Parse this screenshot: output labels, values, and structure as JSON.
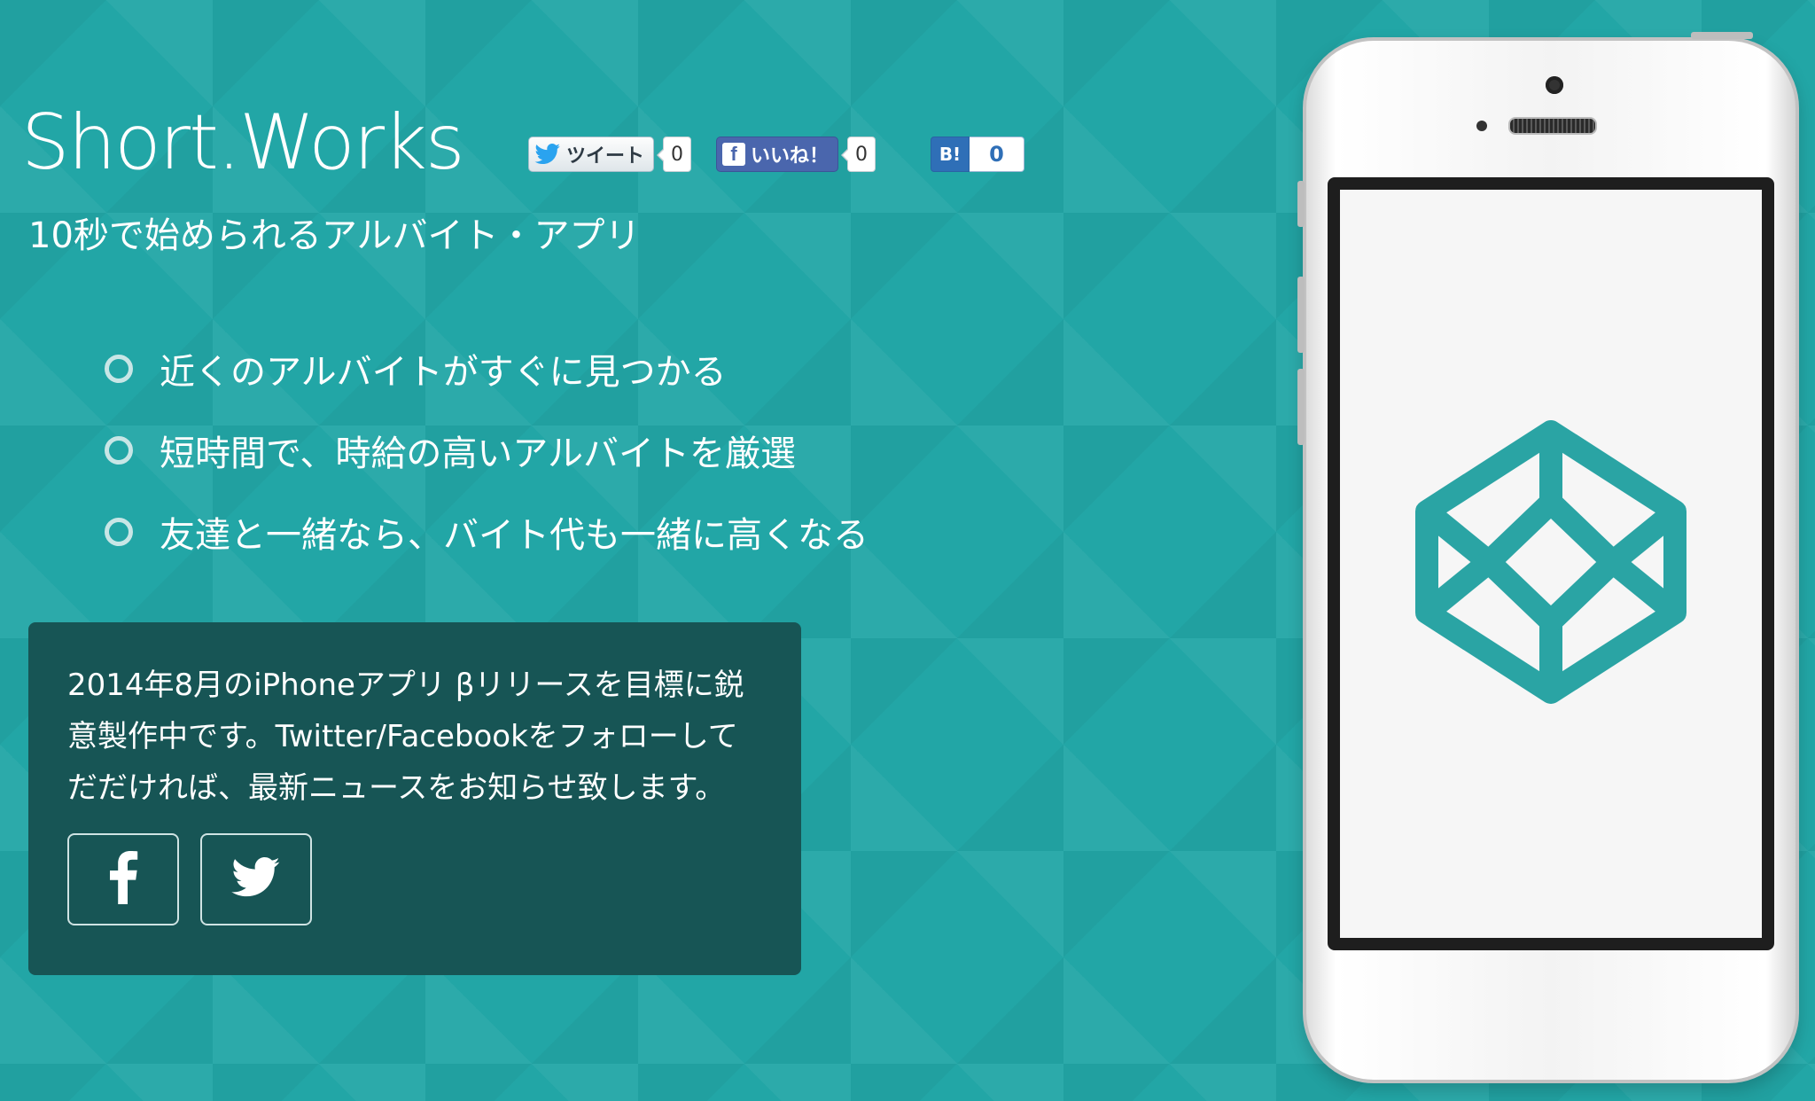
{
  "brand": {
    "name": "Short.Works",
    "tagline": "10秒で始められるアルバイト・アプリ"
  },
  "share": {
    "tweet_label": "ツイート",
    "tweet_count": "0",
    "like_label": "いいね！",
    "like_count": "0",
    "hatena_label": "B!",
    "hatena_count": "0"
  },
  "features": [
    "近くのアルバイトがすぐに見つかる",
    "短時間で、時給の高いアルバイトを厳選",
    "友達と一緒なら、バイト代も一緒に高くなる"
  ],
  "notice": {
    "lines": [
      "2014年8月のiPhoneアプリ βリリースを目標に鋭",
      "意製作中です。Twitter/Facebookをフォローして",
      "だだければ、最新ニュースをお知らせ致します。"
    ]
  },
  "colors": {
    "background": "#22a6a6",
    "panel": "#175555",
    "accent": "#2aa4a4",
    "facebook": "#4a66ad",
    "hatena": "#2f6fb7"
  },
  "icons": {
    "twitter": "twitter-bird-icon",
    "facebook": "facebook-f-icon",
    "app_logo": "cube-logo-icon"
  }
}
